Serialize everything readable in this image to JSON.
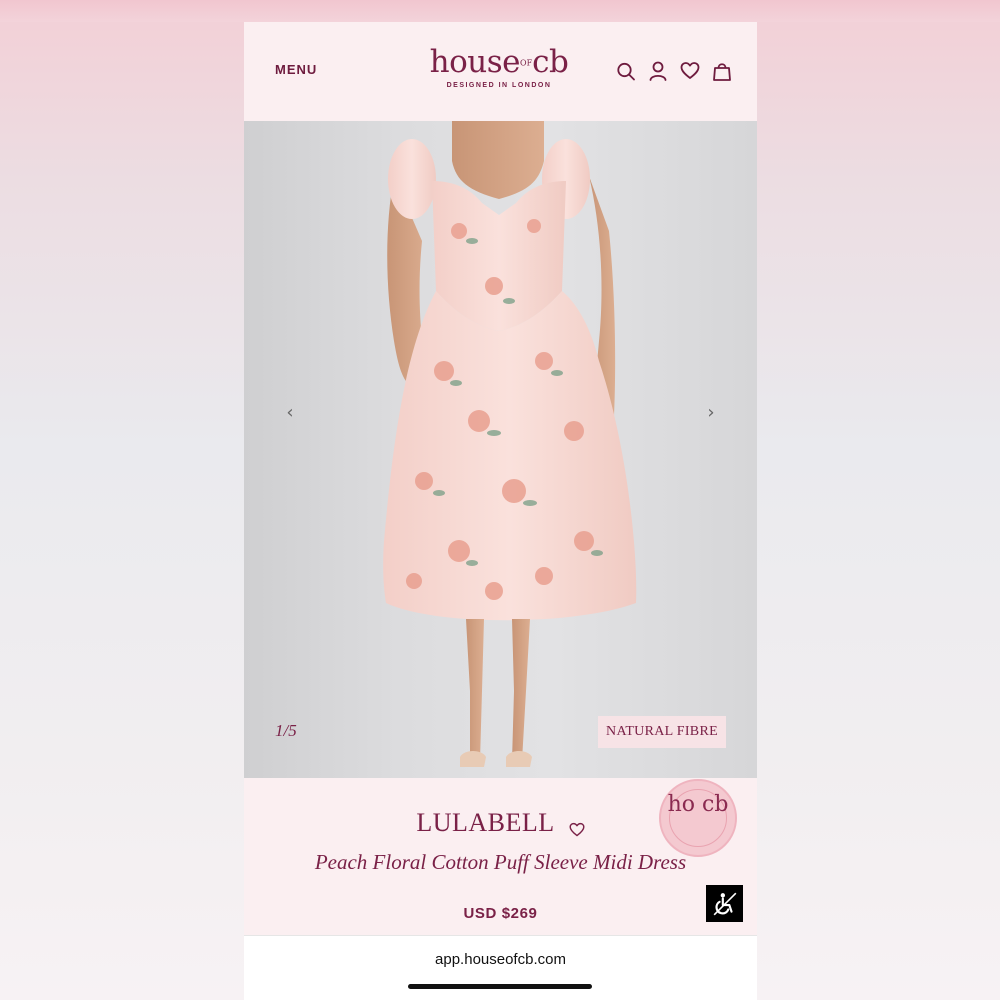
{
  "header": {
    "menu_label": "MENU",
    "logo_main_1": "house",
    "logo_of": "OF",
    "logo_main_2": "cb",
    "logo_tagline": "DESIGNED IN LONDON",
    "icons": [
      "search-icon",
      "account-icon",
      "wishlist-heart-icon",
      "shopping-bag-icon"
    ]
  },
  "gallery": {
    "counter": "1/5",
    "badge": "NATURAL FIBRE",
    "prev_arrow": "‹",
    "next_arrow": "›"
  },
  "product": {
    "name": "LULABELL",
    "subtitle": "Peach Floral Cotton Puff Sleeve Midi Dress",
    "price": "USD $269",
    "stamp_letters": "ho cb"
  },
  "browser": {
    "url": "app.houseofcb.com"
  },
  "colors": {
    "brand": "#7a2147",
    "header_bg": "#fbeff1",
    "badge_bg": "#f7e3e6"
  }
}
